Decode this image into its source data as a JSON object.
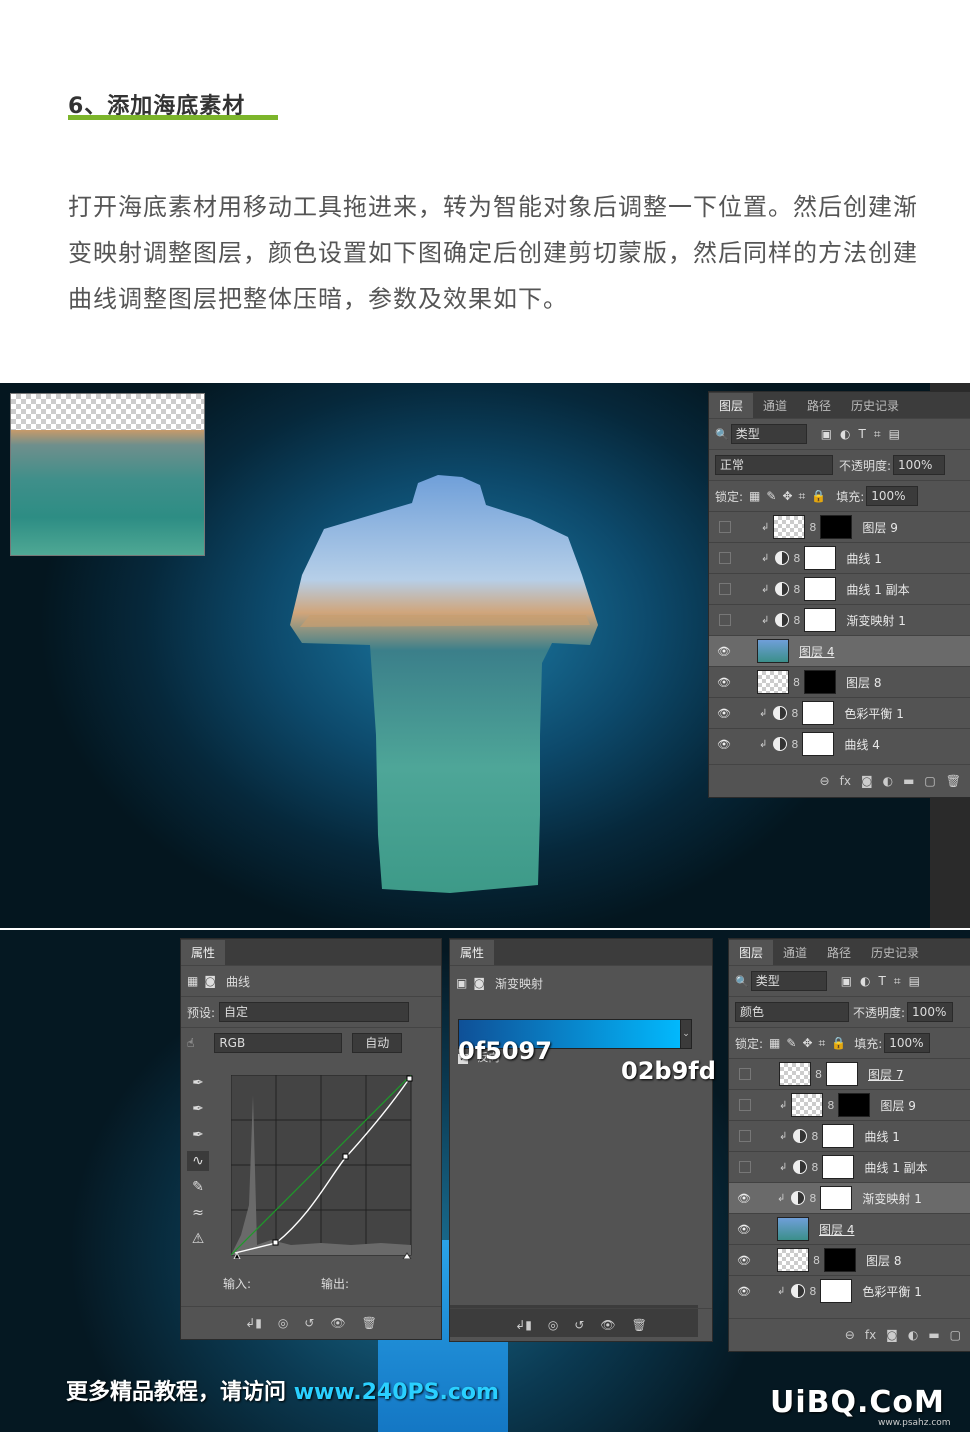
{
  "article": {
    "step_title": "6、添加海底素材",
    "paragraph": "打开海底素材用移动工具拖进来，转为智能对象后调整一下位置。然后创建渐变映射调整图层，颜色设置如下图确定后创建剪切蒙版，然后同样的方法创建曲线调整图层把整体压暗，参数及效果如下。",
    "accent_color": "#7cb52b"
  },
  "layers_panel_top": {
    "tabs": [
      "图层",
      "通道",
      "路径",
      "历史记录"
    ],
    "filter_label": "类型",
    "blend_mode": "正常",
    "opacity_label": "不透明度:",
    "opacity_value": "100%",
    "lock_label": "锁定:",
    "fill_label": "填充:",
    "fill_value": "100%",
    "layers": [
      {
        "name": "图层 9",
        "visible": false
      },
      {
        "name": "曲线 1",
        "visible": false
      },
      {
        "name": "曲线 1 副本",
        "visible": false
      },
      {
        "name": "渐变映射 1",
        "visible": false
      },
      {
        "name": "图层 4",
        "visible": true
      },
      {
        "name": "图层 8",
        "visible": true
      },
      {
        "name": "色彩平衡 1",
        "visible": true
      },
      {
        "name": "曲线 4",
        "visible": true
      }
    ],
    "footer_fx": "fx"
  },
  "curves_panel": {
    "title": "属性",
    "type_label": "曲线",
    "preset_label": "预设:",
    "preset_value": "自定",
    "channel": "RGB",
    "auto_button": "自动",
    "input_label": "输入:",
    "output_label": "输出:"
  },
  "gradient_panel": {
    "title": "属性",
    "type_label": "渐变映射",
    "reverse_label": "反向",
    "color_start": "0f5097",
    "color_end": "02b9fd"
  },
  "layers_panel_bottom": {
    "tabs": [
      "图层",
      "通道",
      "路径",
      "历史记录"
    ],
    "filter_label": "类型",
    "blend_mode": "颜色",
    "opacity_label": "不透明度:",
    "opacity_value": "100%",
    "lock_label": "锁定:",
    "fill_label": "填充:",
    "fill_value": "100%",
    "layers": [
      {
        "name": "图层 7",
        "visible": false
      },
      {
        "name": "图层 9",
        "visible": false
      },
      {
        "name": "曲线 1",
        "visible": false
      },
      {
        "name": "曲线 1 副本",
        "visible": false
      },
      {
        "name": "渐变映射 1",
        "visible": true
      },
      {
        "name": "图层 4",
        "visible": true
      },
      {
        "name": "图层 8",
        "visible": true
      },
      {
        "name": "色彩平衡 1",
        "visible": true
      }
    ],
    "footer_fx": "fx"
  },
  "watermarks": {
    "promo_text": "更多精品教程，请访问",
    "promo_url": "www.240PS.com",
    "logo": "UiBQ.CoM",
    "logo_sub": "www.psahz.com"
  }
}
